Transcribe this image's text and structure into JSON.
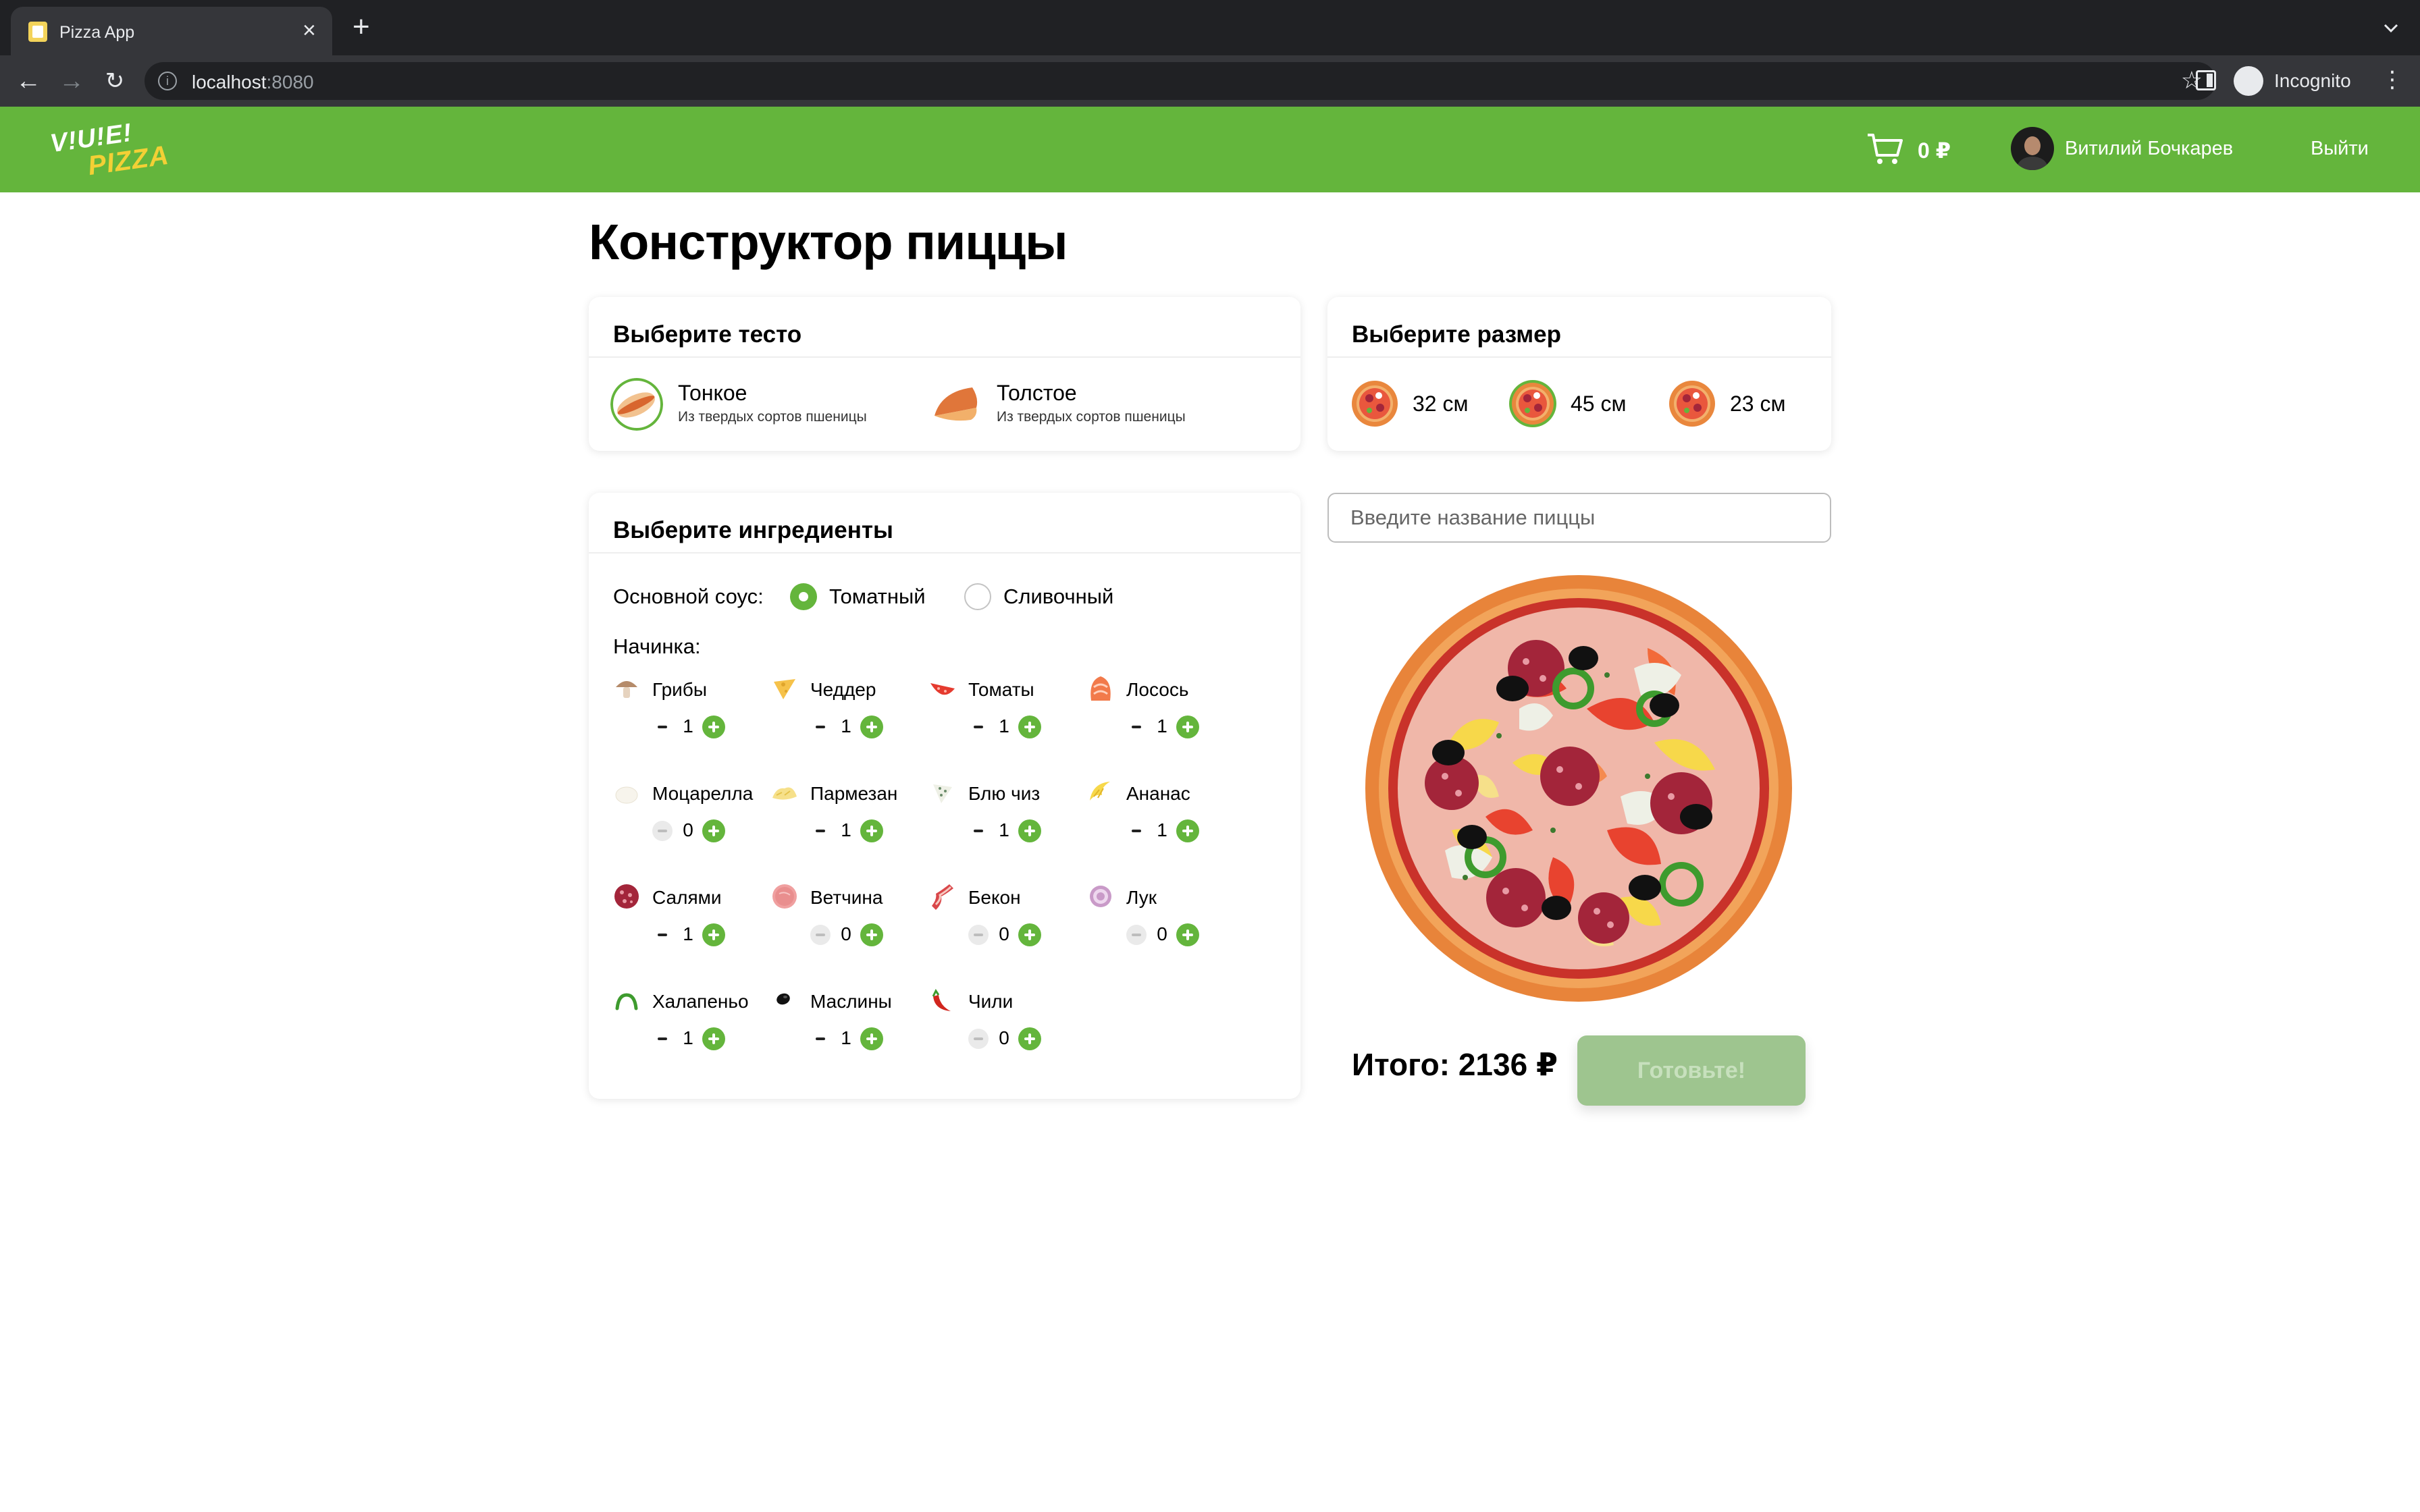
{
  "browser": {
    "tab_title": "Pizza App",
    "url_host": "localhost",
    "url_port": ":8080",
    "incognito_label": "Incognito"
  },
  "header": {
    "logo_line1": "V!U!E!",
    "logo_line2": "PIZZA",
    "cart_total": "0 ₽",
    "user_name": "Витилий Бочкарев",
    "logout_label": "Выйти"
  },
  "page": {
    "title": "Конструктор пиццы"
  },
  "dough": {
    "title": "Выберите тесто",
    "options": [
      {
        "name": "Тонкое",
        "desc": "Из твердых сортов пшеницы",
        "icon": "thin-dough-icon"
      },
      {
        "name": "Толстое",
        "desc": "Из твердых сортов пшеницы",
        "icon": "thick-dough-icon"
      }
    ]
  },
  "size": {
    "title": "Выберите размер",
    "options": [
      {
        "label": "32 см",
        "selected": false
      },
      {
        "label": "45 см",
        "selected": true
      },
      {
        "label": "23 см",
        "selected": false
      }
    ]
  },
  "ingredients": {
    "title": "Выберите ингредиенты",
    "sauce_label": "Основной соус:",
    "sauces": [
      {
        "label": "Томатный",
        "checked": true
      },
      {
        "label": "Сливочный",
        "checked": false
      }
    ],
    "filling_label": "Начинка:",
    "items": [
      {
        "name": "Грибы",
        "count": "1",
        "icon": "mushroom-icon"
      },
      {
        "name": "Чеддер",
        "count": "1",
        "icon": "cheddar-icon"
      },
      {
        "name": "Томаты",
        "count": "1",
        "icon": "tomato-icon"
      },
      {
        "name": "Лосось",
        "count": "1",
        "icon": "salmon-icon"
      },
      {
        "name": "Моцарелла",
        "count": "0",
        "icon": "mozzarella-icon"
      },
      {
        "name": "Пармезан",
        "count": "1",
        "icon": "parmesan-icon"
      },
      {
        "name": "Блю чиз",
        "count": "1",
        "icon": "blue-cheese-icon"
      },
      {
        "name": "Ананас",
        "count": "1",
        "icon": "pineapple-icon"
      },
      {
        "name": "Салями",
        "count": "1",
        "icon": "salami-icon"
      },
      {
        "name": "Ветчина",
        "count": "0",
        "icon": "ham-icon"
      },
      {
        "name": "Бекон",
        "count": "0",
        "icon": "bacon-icon"
      },
      {
        "name": "Лук",
        "count": "0",
        "icon": "onion-icon"
      },
      {
        "name": "Халапеньо",
        "count": "1",
        "icon": "jalapeno-icon"
      },
      {
        "name": "Маслины",
        "count": "1",
        "icon": "olives-icon"
      },
      {
        "name": "Чили",
        "count": "0",
        "icon": "chili-icon"
      }
    ]
  },
  "pizza_name": {
    "placeholder": "Введите название пиццы",
    "value": ""
  },
  "footer": {
    "total": "Итого: 2136 ₽",
    "cook_label": "Готовьте!"
  },
  "colors": {
    "brand_green": "#64b53c",
    "disabled_button": "#9ec58f"
  }
}
